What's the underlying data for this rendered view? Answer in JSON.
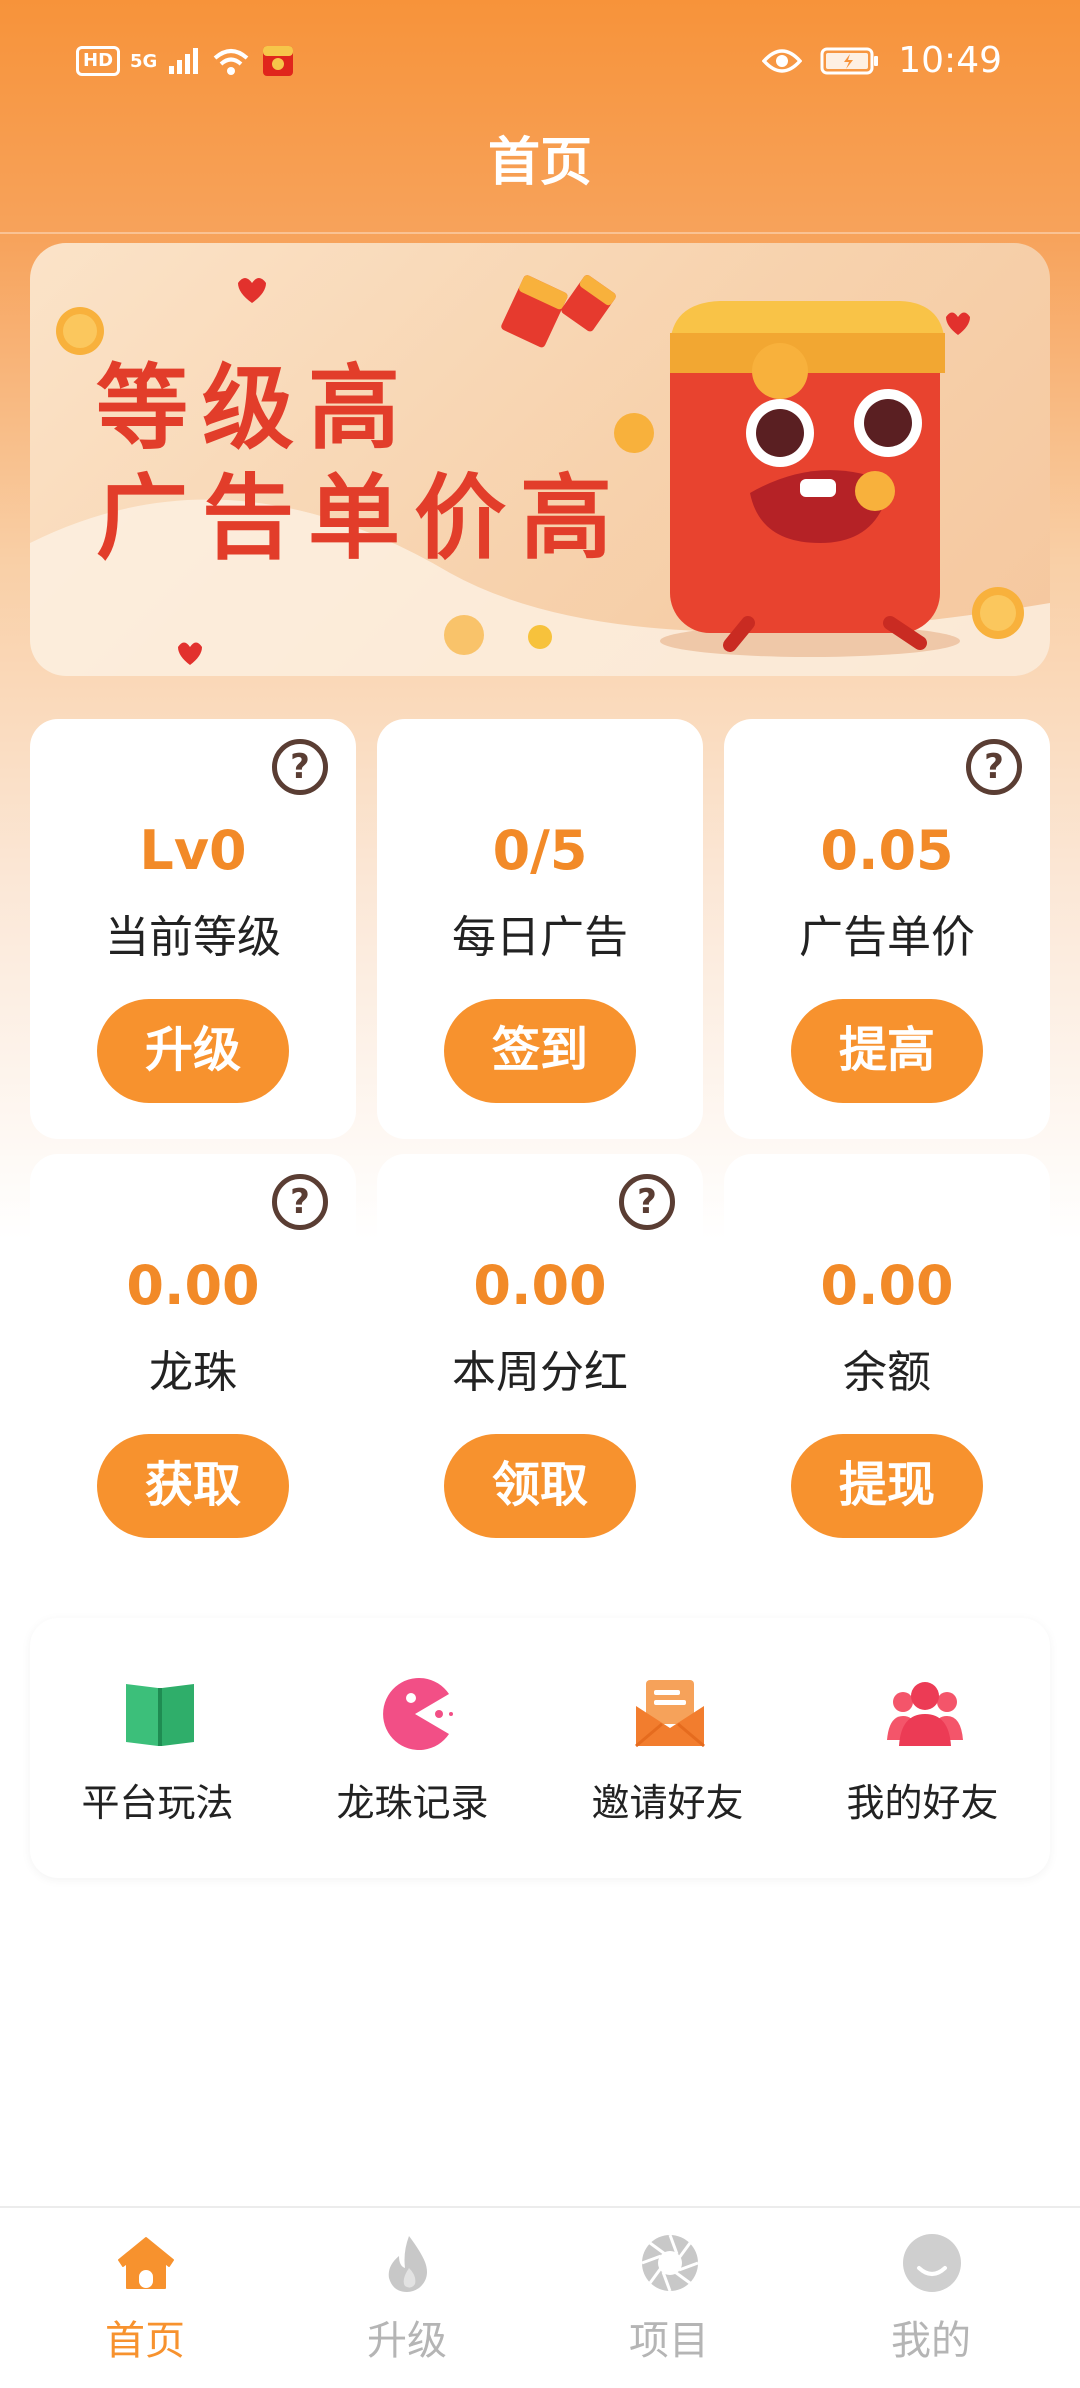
{
  "status_bar": {
    "time": "10:49",
    "indicators": [
      "HD",
      "5G"
    ]
  },
  "header": {
    "title": "首页"
  },
  "banner": {
    "line1": "等级高",
    "line2": "广告单价高"
  },
  "cards": [
    {
      "value": "Lv0",
      "label": "当前等级",
      "action": "升级",
      "has_help": true
    },
    {
      "value": "0/5",
      "label": "每日广告",
      "action": "签到",
      "has_help": false
    },
    {
      "value": "0.05",
      "label": "广告单价",
      "action": "提高",
      "has_help": true
    },
    {
      "value": "0.00",
      "label": "龙珠",
      "action": "获取",
      "has_help": true
    },
    {
      "value": "0.00",
      "label": "本周分红",
      "action": "领取",
      "has_help": true
    },
    {
      "value": "0.00",
      "label": "余额",
      "action": "提现",
      "has_help": false
    }
  ],
  "quick_links": [
    {
      "label": "平台玩法",
      "icon": "book-icon"
    },
    {
      "label": "龙珠记录",
      "icon": "pacman-icon"
    },
    {
      "label": "邀请好友",
      "icon": "mail-icon"
    },
    {
      "label": "我的好友",
      "icon": "users-icon"
    }
  ],
  "tabbar": [
    {
      "label": "首页",
      "icon": "home-icon",
      "active": true
    },
    {
      "label": "升级",
      "icon": "flame-icon",
      "active": false
    },
    {
      "label": "项目",
      "icon": "aperture-icon",
      "active": false
    },
    {
      "label": "我的",
      "icon": "smile-icon",
      "active": false
    }
  ],
  "colors": {
    "primary": "#f7922e",
    "value": "#f28a28",
    "banner_text": "#e23d2a",
    "tab_inactive": "#b5b5b5"
  }
}
